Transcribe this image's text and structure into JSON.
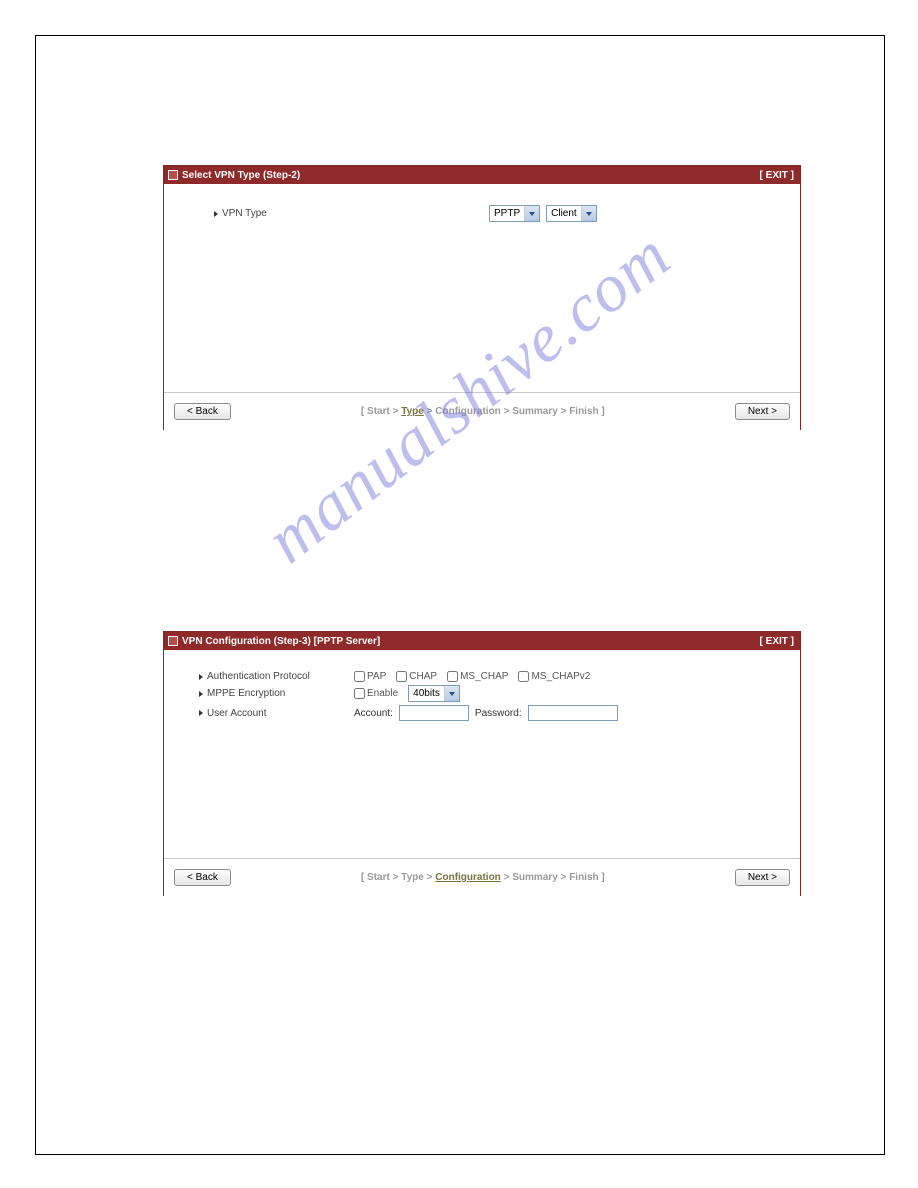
{
  "watermark": "manualshive.com",
  "panel1": {
    "title": "Select VPN Type (Step-2)",
    "exit": "[ EXIT ]",
    "row": {
      "label": "VPN Type",
      "protocol": "PPTP",
      "mode": "Client"
    },
    "back": "< Back",
    "next": "Next >",
    "crumb": {
      "open": "[ ",
      "s1": "Start",
      "s2": "Type",
      "s3": "Configuration",
      "s4": "Summary",
      "s5": "Finish",
      "close": " ]",
      "sep": " > "
    }
  },
  "panel2": {
    "title": "VPN Configuration (Step-3) [PPTP Server]",
    "exit": "[ EXIT ]",
    "rows": {
      "auth": {
        "label": "Authentication Protocol",
        "pap": "PAP",
        "chap": "CHAP",
        "mschap": "MS_CHAP",
        "mschapv2": "MS_CHAPv2"
      },
      "mppe": {
        "label": "MPPE Encryption",
        "enable": "Enable",
        "bits": "40bits"
      },
      "user": {
        "label": "User Account",
        "account": "Account:",
        "password": "Password:"
      }
    },
    "back": "< Back",
    "next": "Next >",
    "crumb": {
      "open": "[ ",
      "s1": "Start",
      "s2": "Type",
      "s3": "Configuration",
      "s4": "Summary",
      "s5": "Finish",
      "close": " ]",
      "sep": " > "
    }
  }
}
